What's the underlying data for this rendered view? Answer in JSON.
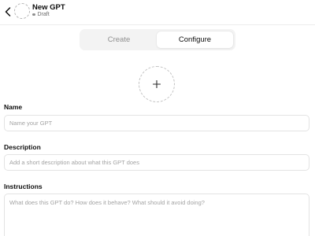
{
  "header": {
    "title": "New GPT",
    "status": "Draft",
    "back_icon": "chevron-left-icon",
    "avatar_icon": "dashed-circle-avatar"
  },
  "tabs": [
    {
      "label": "Create",
      "active": false
    },
    {
      "label": "Configure",
      "active": true
    }
  ],
  "image_upload": {
    "icon": "plus-icon"
  },
  "form": {
    "name": {
      "label": "Name",
      "value": "",
      "placeholder": "Name your GPT"
    },
    "description": {
      "label": "Description",
      "value": "",
      "placeholder": "Add a short description about what this GPT does"
    },
    "instructions": {
      "label": "Instructions",
      "value": "",
      "placeholder": "What does this GPT do? How does it behave? What should it avoid doing?"
    }
  },
  "colors": {
    "accent_text": "#0d0d0d",
    "muted_text": "#8f8f8f",
    "segment_bg": "#f3f3f3",
    "border": "#e3e3e3"
  }
}
